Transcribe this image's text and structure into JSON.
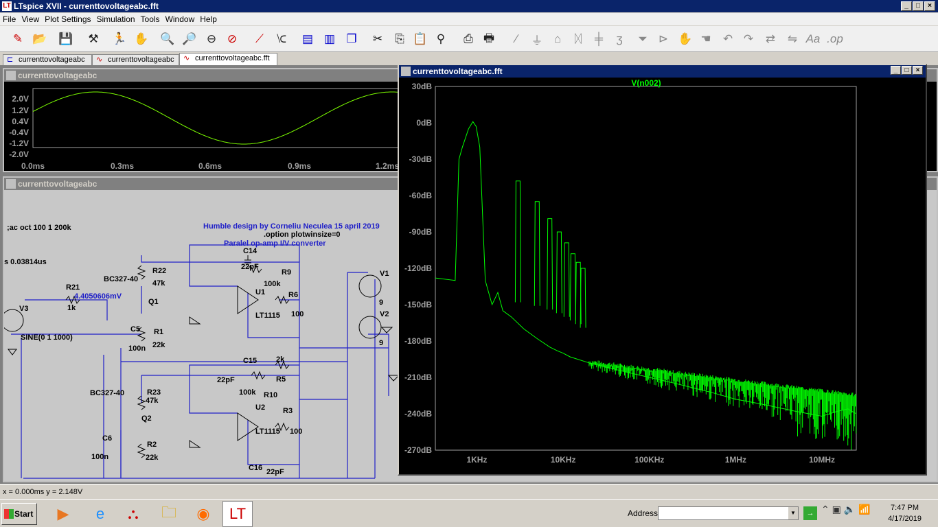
{
  "window": {
    "title": "LTspice XVII - currenttovoltageabc.fft"
  },
  "menu": [
    "File",
    "View",
    "Plot Settings",
    "Simulation",
    "Tools",
    "Window",
    "Help"
  ],
  "tabs": [
    {
      "label": "currenttovoltageabc"
    },
    {
      "label": "currenttovoltageabc"
    },
    {
      "label": "currenttovoltageabc.fft"
    }
  ],
  "transient_window": {
    "title": "currenttovoltageabc",
    "y_ticks": [
      "2.0V",
      "1.2V",
      "0.4V",
      "-0.4V",
      "-1.2V",
      "-2.0V"
    ],
    "x_ticks": [
      "0.0ms",
      "0.3ms",
      "0.6ms",
      "0.9ms",
      "1.2ms"
    ],
    "trace_color": "#7cfc00"
  },
  "schematic_window": {
    "title": "currenttovoltageabc",
    "texts": {
      "ac": ";ac oct 100 1 200k",
      "tran": "s 0.03814us",
      "credit": "Humble design by Corneliu Neculea 15 april 2019",
      "option": ".option plotwinsize=0",
      "converter": "Paralel op-amp I/V converter",
      "meas": "4.4050606mV",
      "c14": "C14",
      "c14v": "22pF",
      "r22": "R22",
      "r22v": "47k",
      "bc1": "BC327-40",
      "r9": "R9",
      "r9v": "100k",
      "r21": "R21",
      "r21v": "1k",
      "q1": "Q1",
      "u1": "U1",
      "u1v": "LT1115",
      "r6": "R6",
      "r6v": "100",
      "v3": "V3",
      "sine": "SINE(0 1 1000)",
      "c5": "C5",
      "c5v": "100n",
      "r1": "R1",
      "r1v": "22k",
      "v1": "V1",
      "v1v": "9",
      "v2": "V2",
      "v2v": "9",
      "c15": "C15",
      "c15v": "22pF",
      "r5": "R5",
      "r5v": "2k",
      "r10": "R10",
      "r10v": "100k",
      "bc2": "BC327-40",
      "r23": "R23",
      "r23v": "47k",
      "q2": "Q2",
      "u2": "U2",
      "u2v": "LT1115",
      "r3": "R3",
      "r3v": "100",
      "c6": "C6",
      "c6v": "100n",
      "r2": "R2",
      "r2v": "22k",
      "c16": "C16",
      "c16v": "22pF"
    }
  },
  "fft_window": {
    "title": "currenttovoltageabc.fft",
    "trace_color": "#00ff00"
  },
  "chart_data": {
    "type": "line",
    "title": "V(n002)",
    "xscale": "log",
    "x_ticks": [
      "1KHz",
      "10KHz",
      "100KHz",
      "1MHz",
      "10MHz"
    ],
    "y_ticks": [
      "30dB",
      "0dB",
      "-30dB",
      "-60dB",
      "-90dB",
      "-120dB",
      "-150dB",
      "-180dB",
      "-210dB",
      "-240dB",
      "-270dB"
    ],
    "ylim": [
      -270,
      30
    ],
    "xlim_hz": [
      330,
      1000000
    ],
    "series": [
      {
        "x_hz": [
          330,
          560,
          620,
          680,
          800,
          900,
          980,
          1080,
          1250,
          1500,
          1750,
          2000,
          2500,
          3500,
          5000,
          7000,
          8500,
          10000,
          12000,
          20000,
          50000,
          100000,
          200000,
          500000,
          1000000,
          2000000,
          5000000,
          10000000,
          15000000,
          20000000,
          25000000
        ],
        "y_db": [
          -128,
          -130,
          -30,
          -20,
          -5,
          1,
          -3,
          -20,
          -130,
          -150,
          -140,
          -155,
          -160,
          -170,
          -178,
          -185,
          -188,
          -190,
          -193,
          -198,
          -205,
          -210,
          -215,
          -222,
          -228,
          -232,
          -238,
          -242,
          -238,
          -236,
          -240
        ]
      }
    ],
    "harmonics_hz": [
      3000,
      5000,
      7000,
      9000,
      11000,
      13000,
      15000,
      17000
    ],
    "harmonics_db": [
      -48,
      -65,
      -79,
      -90,
      -99,
      -108,
      -115,
      -120
    ]
  },
  "status": {
    "coords": "x = 0.000ms   y = 2.148V"
  },
  "taskbar": {
    "start": "Start",
    "address_label": "Address",
    "address_value": "",
    "time": "7:47 PM",
    "date": "4/17/2019"
  }
}
